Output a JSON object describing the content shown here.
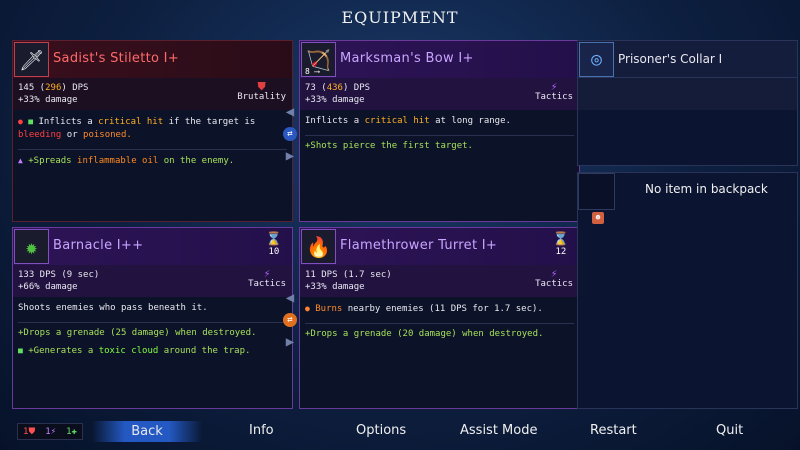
{
  "title": "EQUIPMENT",
  "cards": [
    {
      "name": "Sadist's Stiletto I+",
      "dps_base": "145",
      "dps_crit": "296",
      "dps_suffix": "DPS",
      "damage": "+33% damage",
      "scaling": "Brutality",
      "effect_pre": "Inflicts a",
      "effect_crit": "critical hit",
      "effect_mid": "if the target is",
      "effect_bleed": "bleeding",
      "effect_or": "or",
      "effect_poison": "poisoned.",
      "mod_pre": "Spreads",
      "mod_hl": "inflammable oil",
      "mod_post": "on the enemy."
    },
    {
      "name": "Marksman's Bow I+",
      "icon_badge": "8 ⟶",
      "dps_base": "73",
      "dps_crit": "436",
      "dps_suffix": "DPS",
      "damage": "+33% damage",
      "scaling": "Tactics",
      "effect_pre": "Inflicts a",
      "effect_crit": "critical hit",
      "effect_post": "at long range.",
      "mod": "Shots pierce the first target."
    },
    {
      "name": "Barnacle I++",
      "cooldown": "10",
      "dps": "133 DPS (9 sec)",
      "damage": "+66% damage",
      "scaling": "Tactics",
      "effect": "Shoots enemies who pass beneath it.",
      "mod1": "Drops a grenade (25 damage) when destroyed.",
      "mod2_pre": "Generates a",
      "mod2_hl": "toxic cloud",
      "mod2_post": "around the trap."
    },
    {
      "name": "Flamethrower Turret I+",
      "cooldown": "12",
      "dps": "11 DPS (1.7 sec)",
      "damage": "+33% damage",
      "scaling": "Tactics",
      "effect_hl": "Burns",
      "effect_post": "nearby enemies (11 DPS for 1.7 sec).",
      "mod": "Drops a grenade (20 damage) when destroyed."
    }
  ],
  "amulet": {
    "name": "Prisoner's Collar I"
  },
  "backpack": {
    "text": "No item in backpack"
  },
  "counters": {
    "brutality": "1",
    "tactics": "1",
    "survival": "1"
  },
  "menu": {
    "back": "Back",
    "info": "Info",
    "options": "Options",
    "assist": "Assist Mode",
    "restart": "Restart",
    "quit": "Quit"
  },
  "colors": {
    "brutality": "#e04040",
    "tactics": "#b060ff",
    "survival": "#60e060",
    "crit": "#ffb020",
    "highlight_bar": "#2864dc"
  },
  "icons": [
    "dagger-icon",
    "bow-icon",
    "barnacle-icon",
    "flamethrower-icon",
    "hourglass-icon",
    "collar-icon",
    "swap-icon"
  ]
}
